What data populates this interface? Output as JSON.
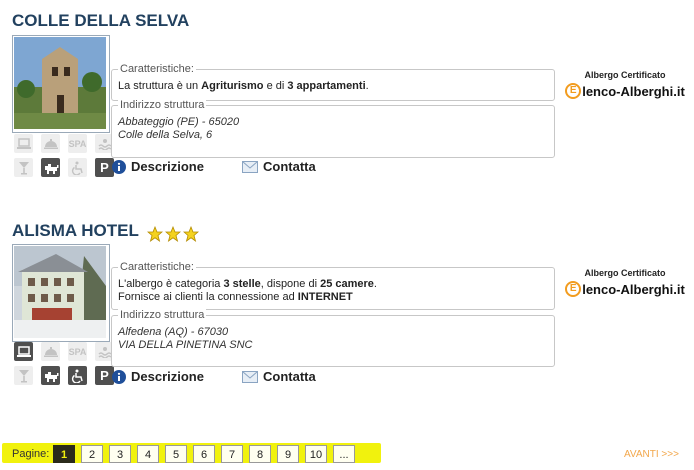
{
  "hotels": [
    {
      "name": "COLLE DELLA SELVA",
      "stars": 0,
      "caratteristiche_legend": "Caratteristiche:",
      "features_html": "La struttura è un <b>Agriturismo</b> e di <b>3 appartamenti</b>.",
      "indirizzo_legend": "Indirizzo struttura",
      "address_line1": "Abbateggio (PE) - 65020",
      "address_line2": "Colle della Selva, 6",
      "descrizione_label": "Descrizione",
      "contatta_label": "Contatta",
      "cert_label": "Albergo Certificato",
      "cert_brand": "lenco-Alberghi.it",
      "amenities": [
        {
          "name": "laptop-icon",
          "on": false
        },
        {
          "name": "restaurant-icon",
          "on": false
        },
        {
          "name": "spa-icon",
          "on": false,
          "text": "SPA"
        },
        {
          "name": "pool-icon",
          "on": false
        },
        {
          "name": "cocktail-icon",
          "on": false
        },
        {
          "name": "pet-icon",
          "on": true
        },
        {
          "name": "wheelchair-icon",
          "on": false
        },
        {
          "name": "parking-icon",
          "on": true,
          "text": "P"
        }
      ]
    },
    {
      "name": "ALISMA HOTEL",
      "stars": 3,
      "caratteristiche_legend": "Caratteristiche:",
      "features_html": "L'albergo è categoria <b>3 stelle</b>, dispone di <b>25 camere</b>.<br>Fornisce ai clienti la connessione ad <b>INTERNET</b>",
      "indirizzo_legend": "Indirizzo struttura",
      "address_line1": "Alfedena (AQ) - 67030",
      "address_line2": "VIA DELLA PINETINA SNC",
      "descrizione_label": "Descrizione",
      "contatta_label": "Contatta",
      "cert_label": "Albergo Certificato",
      "cert_brand": "lenco-Alberghi.it",
      "amenities": [
        {
          "name": "laptop-icon",
          "on": true
        },
        {
          "name": "restaurant-icon",
          "on": false
        },
        {
          "name": "spa-icon",
          "on": false,
          "text": "SPA"
        },
        {
          "name": "pool-icon",
          "on": false
        },
        {
          "name": "cocktail-icon",
          "on": false
        },
        {
          "name": "pet-icon",
          "on": true
        },
        {
          "name": "wheelchair-icon",
          "on": true
        },
        {
          "name": "parking-icon",
          "on": true,
          "text": "P"
        }
      ]
    }
  ],
  "pagination": {
    "label": "Pagine:",
    "pages": [
      "1",
      "2",
      "3",
      "4",
      "5",
      "6",
      "7",
      "8",
      "9",
      "10",
      "..."
    ],
    "current": "1",
    "next": "AVANTI >>>"
  },
  "colors": {
    "title": "#22415f",
    "highlight": "#f1f20d",
    "next_link": "#f2a74b",
    "brand_orange": "#f29c1f"
  }
}
